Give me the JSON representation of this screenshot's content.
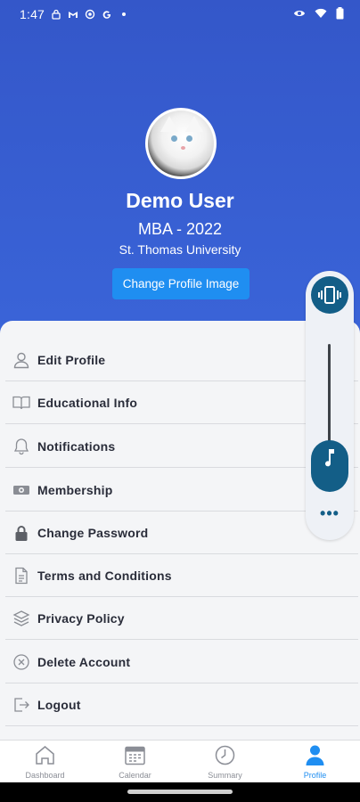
{
  "status_bar": {
    "time": "1:47",
    "left_icons": [
      "lock-icon",
      "gmail-icon",
      "circle-icon",
      "google-icon",
      "dot-icon"
    ],
    "right_icons": [
      "eye-icon",
      "wifi-icon",
      "battery-icon"
    ]
  },
  "profile": {
    "name": "Demo User",
    "degree": "MBA - 2022",
    "school": "St. Thomas University",
    "change_image_label": "Change Profile Image"
  },
  "menu": {
    "items": [
      {
        "label": "Edit Profile",
        "icon": "person-icon"
      },
      {
        "label": "Educational Info",
        "icon": "book-icon"
      },
      {
        "label": "Notifications",
        "icon": "bell-icon"
      },
      {
        "label": "Membership",
        "icon": "money-icon"
      },
      {
        "label": "Change Password",
        "icon": "lock-icon"
      },
      {
        "label": "Terms and Conditions",
        "icon": "document-icon"
      },
      {
        "label": "Privacy Policy",
        "icon": "layers-icon"
      },
      {
        "label": "Delete Account",
        "icon": "close-circle-icon"
      },
      {
        "label": "Logout",
        "icon": "logout-icon"
      }
    ]
  },
  "volume_panel": {
    "top_icon": "vibrate-icon",
    "slider_icon": "music-note-icon",
    "more_label": "•••"
  },
  "tabs": [
    {
      "label": "Dashboard",
      "icon": "home-icon",
      "active": false
    },
    {
      "label": "Calendar",
      "icon": "calendar-icon",
      "active": false
    },
    {
      "label": "Summary",
      "icon": "clock-icon",
      "active": false
    },
    {
      "label": "Profile",
      "icon": "person-icon",
      "active": true
    }
  ],
  "colors": {
    "header": "#3a5fd4",
    "accent": "#1f8ef1",
    "volume_accent": "#135e87",
    "menu_bg": "#f4f5f7"
  }
}
